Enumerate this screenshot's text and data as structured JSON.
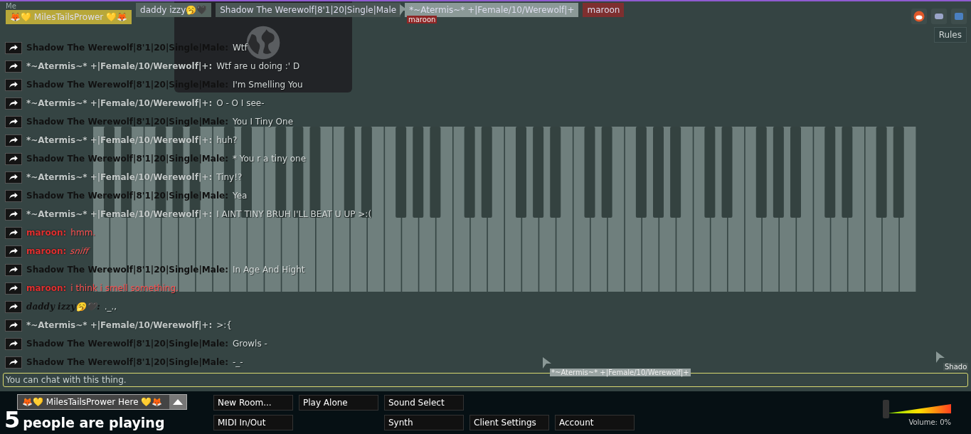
{
  "participants": [
    {
      "name": "🦊💛 MilesTailsPrower 💛🦊",
      "color": "#b8a83a",
      "tag": "Me"
    },
    {
      "name": "daddy izzy🥱🖤",
      "color": "#55645f"
    },
    {
      "name": "Shadow The Werewolf|8'1|20|Single|Male",
      "color": "#4b5755"
    },
    {
      "name": "*~Atermis~* +|Female/10/Werewolf|+",
      "color": "#8b9997"
    },
    {
      "name": "maroon",
      "color": "#7e2f2f"
    }
  ],
  "top_buttons": {
    "rules": "Rules"
  },
  "chat": [
    {
      "name": "Shadow The Werewolf|8'1|20|Single|Male:",
      "text": "Wtf",
      "kind": "dark",
      "italic": false
    },
    {
      "name": "*~Atermis~* +|Female/10/Werewolf|+:",
      "text": "Wtf are u doing :' D",
      "kind": "light",
      "italic": false
    },
    {
      "name": "Shadow The Werewolf|8'1|20|Single|Male:",
      "text": "I'm Smelling You",
      "kind": "dark",
      "italic": false
    },
    {
      "name": "*~Atermis~* +|Female/10/Werewolf|+:",
      "text": "O - O I see-",
      "kind": "light",
      "italic": false
    },
    {
      "name": "Shadow The Werewolf|8'1|20|Single|Male:",
      "text": "You I Tiny One",
      "kind": "dark",
      "italic": false
    },
    {
      "name": "*~Atermis~* +|Female/10/Werewolf|+:",
      "text": "huh?",
      "kind": "light",
      "italic": false
    },
    {
      "name": "Shadow The Werewolf|8'1|20|Single|Male:",
      "text": "* You r a tiny one",
      "kind": "dark",
      "italic": false
    },
    {
      "name": "*~Atermis~* +|Female/10/Werewolf|+:",
      "text": "Tiny!?",
      "kind": "light",
      "italic": false
    },
    {
      "name": "Shadow The Werewolf|8'1|20|Single|Male:",
      "text": "Yea",
      "kind": "dark",
      "italic": false
    },
    {
      "name": "*~Atermis~* +|Female/10/Werewolf|+:",
      "text": "I AINT TINY BRUH I'LL BEAT U UP >:(",
      "kind": "light",
      "italic": false
    },
    {
      "name": "maroon:",
      "text": "hmm.",
      "kind": "red",
      "italic": false
    },
    {
      "name": "maroon:",
      "text": "sniff",
      "kind": "red",
      "italic": true
    },
    {
      "name": "Shadow The Werewolf|8'1|20|Single|Male:",
      "text": "In Age And Hight",
      "kind": "dark",
      "italic": false
    },
    {
      "name": "maroon:",
      "text": "i think i smell something.",
      "kind": "red",
      "italic": false
    },
    {
      "name": "daddy izzy🥱🖤:",
      "text": "._.,",
      "kind": "fancy",
      "italic": false
    },
    {
      "name": "*~Atermis~* +|Female/10/Werewolf|+:",
      "text": ">:{",
      "kind": "light",
      "italic": false
    },
    {
      "name": "Shadow The Werewolf|8'1|20|Single|Male:",
      "text": "Growls -",
      "kind": "dark",
      "italic": false
    },
    {
      "name": "Shadow The Werewolf|8'1|20|Single|Male:",
      "text": "-_-",
      "kind": "dark",
      "italic": false
    }
  ],
  "chat_input": {
    "placeholder": "You can chat with this thing."
  },
  "cursors": [
    {
      "label": "maroon",
      "color": "#8e2525"
    },
    {
      "label": "*~Atermis~* +|Female/10/Werewolf|+",
      "color": "#9aa4a3"
    },
    {
      "label": "Shado",
      "color": "#445250"
    }
  ],
  "room": {
    "name": "🦊💛 MilesTailsPrower Here 💛🦊",
    "count": "5",
    "count_label": "people are playing"
  },
  "buttons": [
    [
      "New Room...",
      "Play Alone",
      "Sound Select"
    ],
    [
      "MIDI In/Out",
      "Synth",
      "Client Settings",
      "Account"
    ]
  ],
  "volume": {
    "level": 0,
    "label": "Volume: 0%"
  }
}
